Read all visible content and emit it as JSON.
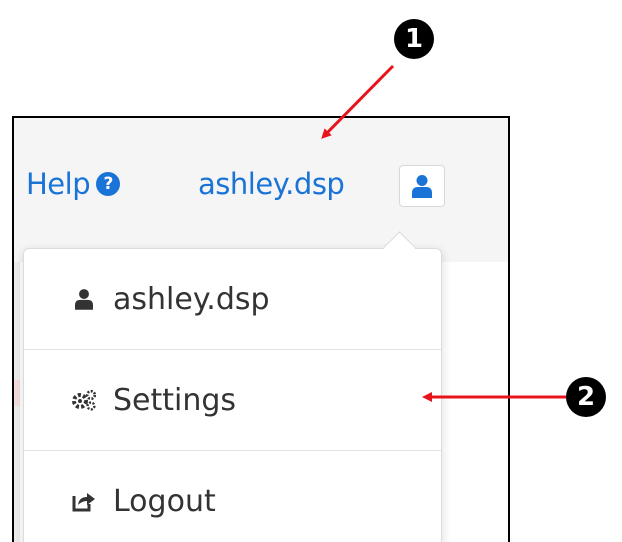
{
  "header": {
    "help_label": "Help",
    "help_icon": "question-circle-icon",
    "username": "ashley.dsp",
    "user_icon": "user-icon"
  },
  "dropdown": {
    "items": [
      {
        "label": "ashley.dsp",
        "icon": "user-icon"
      },
      {
        "label": "Settings",
        "icon": "gears-icon"
      },
      {
        "label": "Logout",
        "icon": "share-square-icon"
      }
    ]
  },
  "callouts": {
    "one": "1",
    "two": "2"
  },
  "colors": {
    "link": "#1a73d6",
    "menu_text": "#333333",
    "arrow": "#e8141b",
    "topbar_bg": "#f5f5f5"
  }
}
